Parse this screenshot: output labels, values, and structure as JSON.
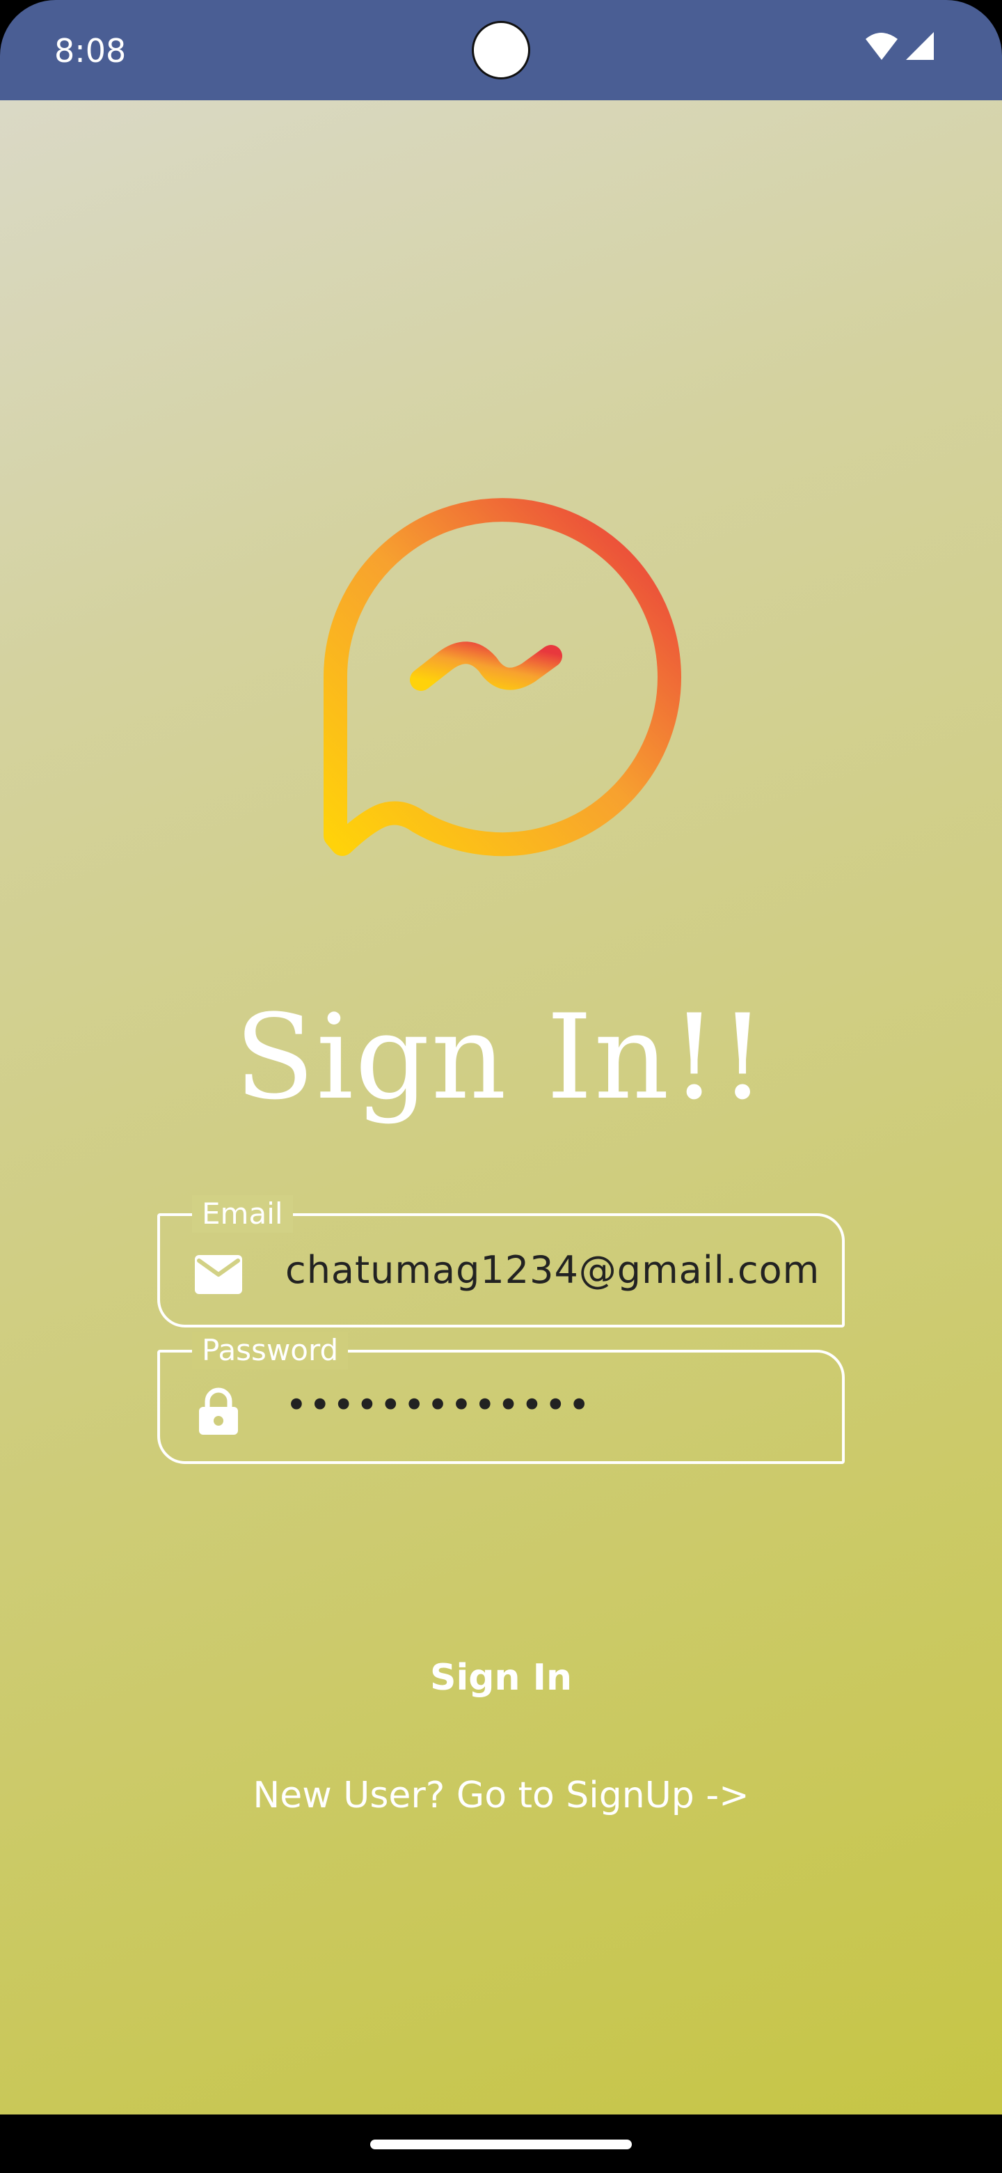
{
  "status_bar": {
    "time": "8:08",
    "icons": [
      "wifi-icon",
      "cellular-signal-icon"
    ],
    "background_color": "#4a5e94"
  },
  "logo": {
    "icon": "chat-bubble-logo-icon",
    "gradient_colors": [
      "#ffd20a",
      "#f7a12f",
      "#e8383d"
    ]
  },
  "title": "Sign In!!",
  "form": {
    "email": {
      "label": "Email",
      "icon": "mail-icon",
      "value": "chatumag1234@gmail.com"
    },
    "password": {
      "label": "Password",
      "icon": "lock-icon",
      "value": "•••••••••••••"
    }
  },
  "sign_in_button": "Sign In",
  "signup_link": "New User? Go to SignUp ->",
  "background_gradient": [
    "#dad9c6",
    "#c6c545"
  ]
}
